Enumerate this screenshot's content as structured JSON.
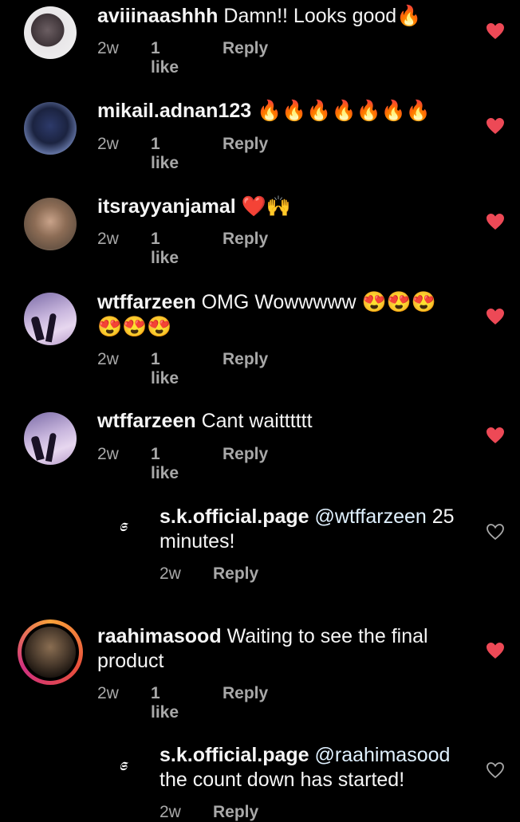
{
  "comments": [
    {
      "username": "aviiinaashhh",
      "text": "Damn!! Looks good🔥",
      "date": "2w",
      "likes": "1 like",
      "reply_label": "Reply"
    },
    {
      "username": "mikail.adnan123",
      "text": "🔥🔥🔥🔥🔥🔥🔥",
      "date": "2w",
      "likes": "1 like",
      "reply_label": "Reply"
    },
    {
      "username": "itsrayyanjamal",
      "text": "❤️🙌",
      "date": "2w",
      "likes": "1 like",
      "reply_label": "Reply"
    },
    {
      "username": "wtffarzeen",
      "text": "OMG Wowwwww 😍😍😍",
      "text2": "😍😍😍",
      "date": "2w",
      "likes": "1 like",
      "reply_label": "Reply"
    },
    {
      "username": "wtffarzeen",
      "text": "Cant waitttttt",
      "date": "2w",
      "likes": "1 like",
      "reply_label": "Reply"
    },
    {
      "username": "raahimasood",
      "text": "Waiting to see the final",
      "text2": "product",
      "date": "2w",
      "likes": "1 like",
      "reply_label": "Reply"
    }
  ],
  "replies": [
    {
      "username": "s.k.official.page",
      "mention": "@wtffarzeen",
      "text": "25",
      "text2": "minutes!",
      "date": "2w",
      "reply_label": "Reply",
      "avatar_glyph": "𝕾"
    },
    {
      "username": "s.k.official.page",
      "mention": "@raahimasood",
      "text2": "the count down has started!",
      "date": "2w",
      "reply_label": "Reply",
      "avatar_glyph": "𝕾"
    }
  ],
  "colors": {
    "heart_liked": "#ed4956",
    "heart_outline": "#a8a8a8",
    "muted": "#a8a8a8",
    "background": "#000000"
  },
  "icons": {
    "liked": "heart-filled-icon",
    "unliked": "heart-outline-icon"
  }
}
